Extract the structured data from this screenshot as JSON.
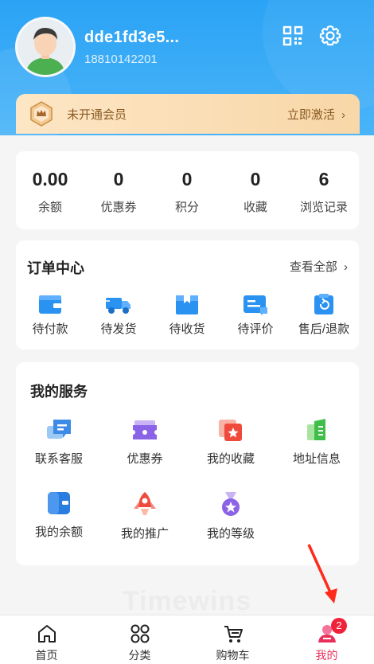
{
  "profile": {
    "username": "dde1fd3e5...",
    "phone": "18810142201"
  },
  "vip": {
    "status_text": "未开通会员",
    "activate_label": "立即激活"
  },
  "stats": [
    {
      "value": "0.00",
      "label": "余额"
    },
    {
      "value": "0",
      "label": "优惠券"
    },
    {
      "value": "0",
      "label": "积分"
    },
    {
      "value": "0",
      "label": "收藏"
    },
    {
      "value": "6",
      "label": "浏览记录"
    }
  ],
  "orders": {
    "title": "订单中心",
    "view_all": "查看全部",
    "items": [
      {
        "label": "待付款",
        "icon": "wallet-icon"
      },
      {
        "label": "待发货",
        "icon": "truck-icon"
      },
      {
        "label": "待收货",
        "icon": "package-icon"
      },
      {
        "label": "待评价",
        "icon": "review-icon"
      },
      {
        "label": "售后/退款",
        "icon": "refund-icon"
      }
    ]
  },
  "services": {
    "title": "我的服务",
    "items": [
      {
        "label": "联系客服",
        "icon": "chat-icon"
      },
      {
        "label": "优惠券",
        "icon": "coupon-icon"
      },
      {
        "label": "我的收藏",
        "icon": "favorite-icon"
      },
      {
        "label": "地址信息",
        "icon": "address-icon"
      },
      {
        "label": "我的余额",
        "icon": "balance-icon"
      },
      {
        "label": "我的推广",
        "icon": "rocket-icon"
      },
      {
        "label": "我的等级",
        "icon": "medal-icon"
      }
    ]
  },
  "watermark": "Timewins",
  "tabbar": {
    "items": [
      {
        "label": "首页",
        "icon": "home-icon"
      },
      {
        "label": "分类",
        "icon": "category-icon"
      },
      {
        "label": "购物车",
        "icon": "cart-icon"
      },
      {
        "label": "我的",
        "icon": "user-icon"
      }
    ],
    "badge": "2"
  },
  "colors": {
    "primary_blue": "#2ba3f5",
    "vip_gold": "#8a5a21",
    "active_tab": "#e8305b",
    "badge_red": "#f0223a"
  }
}
